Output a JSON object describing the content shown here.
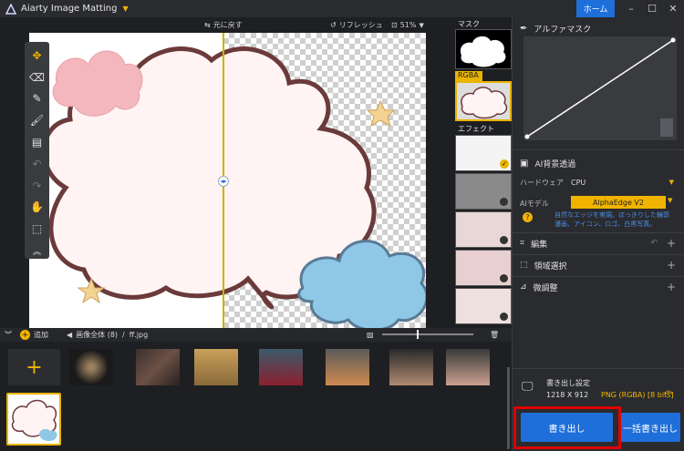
{
  "app": {
    "title": "Aiarty Image Matting",
    "home_label": "ホーム"
  },
  "canvas_toolbar": {
    "undo_label": "元に戻す",
    "refresh_label": "リフレッシュ",
    "zoom": "51%"
  },
  "thumbs": {
    "mask_label": "マスク",
    "rgba_label": "RGBA",
    "effect_label": "エフェクト"
  },
  "alpha": {
    "title": "アルファマスク"
  },
  "ai_bg": {
    "title": "AI背景透過",
    "hardware_label": "ハードウェア",
    "hardware_value": "CPU",
    "model_label": "AIモデル",
    "model_value": "AlphaEdge V2",
    "model_desc": "自然なエッジを実現。ほっきりした輪郭 漫画、アイコン、ロゴ、白黒写真。"
  },
  "sections": [
    {
      "label": "編集"
    },
    {
      "label": "領域選択"
    },
    {
      "label": "微調整"
    }
  ],
  "export": {
    "settings_label": "書き出し設定",
    "resolution": "1218 X 912",
    "format": "PNG (RGBA) [8 bits]",
    "export_label": "書き出し",
    "batch_label": "一括書き出し"
  },
  "bottombar": {
    "add_label": "追加",
    "path_root": "画像全体 (8)",
    "path_sep": "/",
    "path_file": "ff.jpg"
  },
  "colors": {
    "accent": "#1e6fd9",
    "highlight": "#e00000",
    "gold": "#f0b400"
  }
}
